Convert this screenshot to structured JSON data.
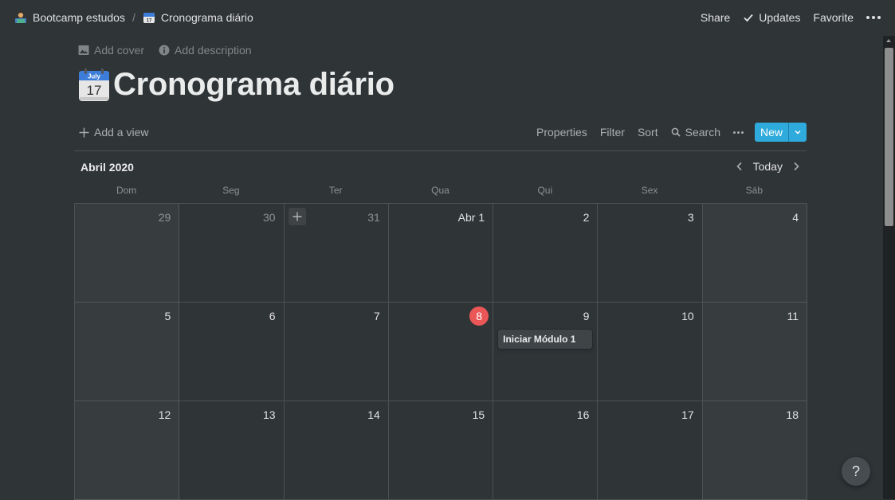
{
  "breadcrumb": {
    "items": [
      {
        "label": "Bootcamp estudos",
        "icon": "technologist-emoji-icon"
      },
      {
        "label": "Cronograma diário",
        "icon": "calendar-emoji-icon"
      }
    ],
    "separator": "/"
  },
  "topbar": {
    "share": "Share",
    "updates": "Updates",
    "favorite": "Favorite",
    "more_icon": "more-horizontal-icon"
  },
  "page_actions": {
    "add_cover": "Add cover",
    "add_description": "Add description"
  },
  "page": {
    "title": "Cronograma diário",
    "icon": "calendar-emoji-icon",
    "icon_month": "July",
    "icon_day": "17"
  },
  "view_toolbar": {
    "add_view": "Add a view",
    "properties": "Properties",
    "filter": "Filter",
    "sort": "Sort",
    "search": "Search",
    "new_label": "New"
  },
  "calendar": {
    "month_label": "Abril 2020",
    "today_label": "Today",
    "weekdays": [
      "Dom",
      "Seg",
      "Ter",
      "Qua",
      "Qui",
      "Sex",
      "Sáb"
    ],
    "weeks": [
      [
        {
          "label": "29",
          "muted": true
        },
        {
          "label": "30",
          "muted": true
        },
        {
          "label": "31",
          "muted": true,
          "hover_add": true
        },
        {
          "label": "Abr 1"
        },
        {
          "label": "2"
        },
        {
          "label": "3"
        },
        {
          "label": "4"
        }
      ],
      [
        {
          "label": "5"
        },
        {
          "label": "6"
        },
        {
          "label": "7"
        },
        {
          "label": "8",
          "today": true
        },
        {
          "label": "9",
          "events": [
            "Iniciar Módulo 1"
          ]
        },
        {
          "label": "10"
        },
        {
          "label": "11"
        }
      ],
      [
        {
          "label": "12"
        },
        {
          "label": "13"
        },
        {
          "label": "14"
        },
        {
          "label": "15"
        },
        {
          "label": "16"
        },
        {
          "label": "17"
        },
        {
          "label": "18"
        }
      ]
    ]
  },
  "help_button": "?",
  "colors": {
    "background": "#2f3437",
    "weekend_background": "#373c3f",
    "accent_blue": "#2eaadc",
    "today_red": "#eb5757"
  }
}
